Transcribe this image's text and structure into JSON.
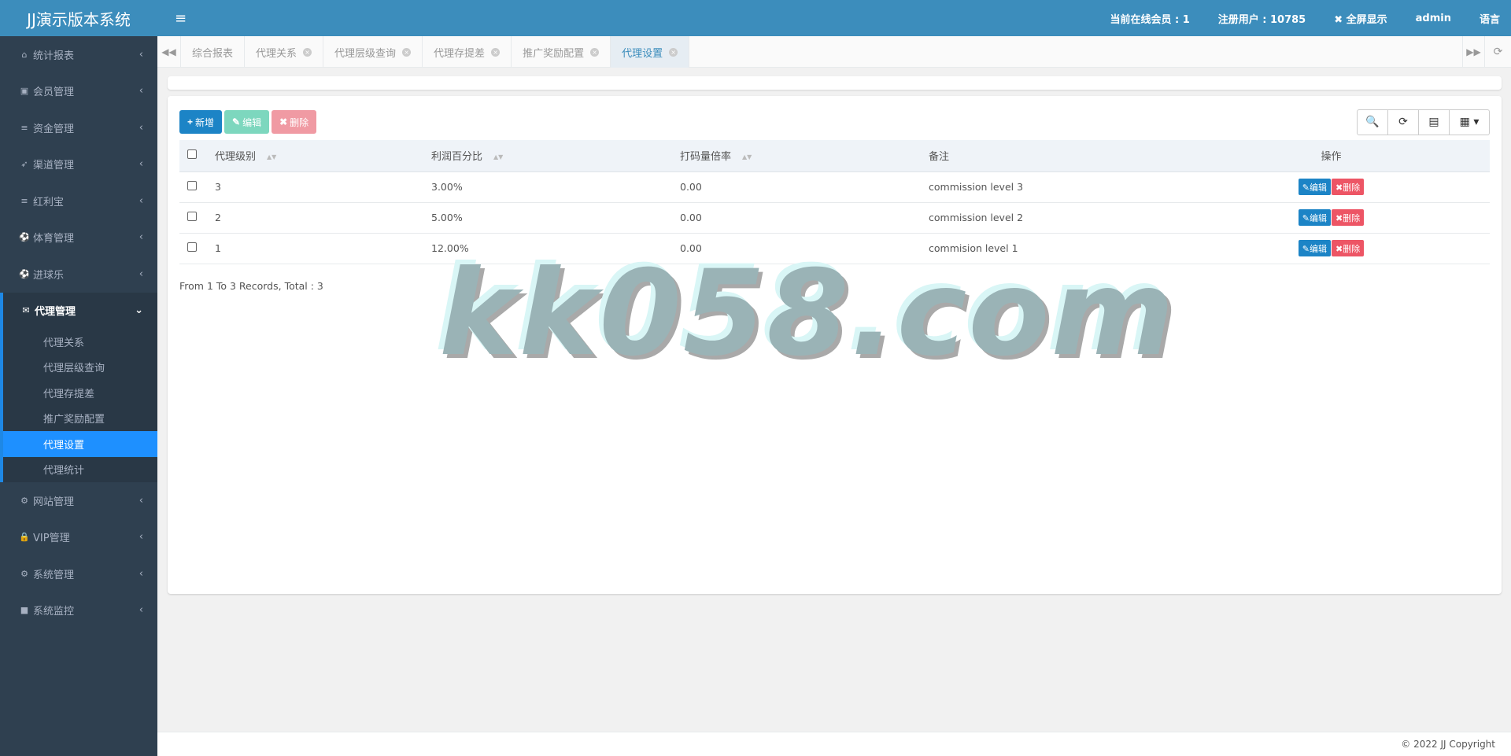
{
  "brand": "JJ演示版本系统",
  "sidebar": {
    "items": [
      {
        "label": "统计报表",
        "icon": "home-icon",
        "glyph": "⌂"
      },
      {
        "label": "会员管理",
        "icon": "address-card-icon",
        "glyph": "▣"
      },
      {
        "label": "资金管理",
        "icon": "database-icon",
        "glyph": "≡"
      },
      {
        "label": "渠道管理",
        "icon": "rocket-icon",
        "glyph": "➶"
      },
      {
        "label": "红利宝",
        "icon": "database-icon",
        "glyph": "≡"
      },
      {
        "label": "体育管理",
        "icon": "soccer-ball-icon",
        "glyph": "⚽"
      },
      {
        "label": "进球乐",
        "icon": "soccer-ball-icon",
        "glyph": "⚽"
      },
      {
        "label": "代理管理",
        "icon": "envelope-icon",
        "glyph": "✉"
      },
      {
        "label": "网站管理",
        "icon": "cogs-icon",
        "glyph": "⚙"
      },
      {
        "label": "VIP管理",
        "icon": "lock-icon",
        "glyph": "🔒"
      },
      {
        "label": "系统管理",
        "icon": "gear-icon",
        "glyph": "⚙"
      },
      {
        "label": "系统监控",
        "icon": "video-camera-icon",
        "glyph": "■"
      }
    ],
    "arrow_collapsed": "‹",
    "arrow_open": "⌄",
    "submenu": [
      "代理关系",
      "代理层级查询",
      "代理存提差",
      "推广奖励配置",
      "代理设置",
      "代理统计"
    ]
  },
  "topbar": {
    "hamburger": "≡",
    "online": "当前在线会员 : 1",
    "registered": "注册用户 : 10785",
    "fullscreen": "✖ 全屏显示",
    "user": "admin",
    "language": "语言"
  },
  "tabs": {
    "prev": "◀◀",
    "next": "▶▶",
    "refresh": "⟳",
    "close": "×",
    "items": [
      "综合报表",
      "代理关系",
      "代理层级查询",
      "代理存提差",
      "推广奖励配置",
      "代理设置"
    ]
  },
  "toolbar": {
    "add_glyph": "+",
    "add": "新增",
    "edit_glyph": "✎",
    "edit": "编辑",
    "delete_glyph": "✖",
    "delete": "删除",
    "search_glyph": "🔍",
    "refresh_glyph": "⟳",
    "toggle_glyph": "▤",
    "columns_glyph": "▦ ▾"
  },
  "table": {
    "headers": [
      "代理级别",
      "利润百分比",
      "打码量倍率",
      "备注",
      "操作"
    ],
    "sort_glyph": "▲▼",
    "rows": [
      [
        "3",
        "3.00%",
        "0.00",
        "commission level 3"
      ],
      [
        "2",
        "5.00%",
        "0.00",
        "commission level 2"
      ],
      [
        "1",
        "12.00%",
        "0.00",
        "commision level 1"
      ]
    ],
    "row_edit": "✎编辑",
    "row_delete": "✖删除",
    "summary": "From 1 To 3 Records, Total : 3"
  },
  "watermark": "kk058.com",
  "footer": "© 2022 JJ Copyright",
  "colors": {
    "topbar": "#3c8dbc",
    "sidebar": "#2f4050",
    "active": "#1e90ff",
    "primary": "#1c84c6",
    "danger": "#ed5565"
  }
}
